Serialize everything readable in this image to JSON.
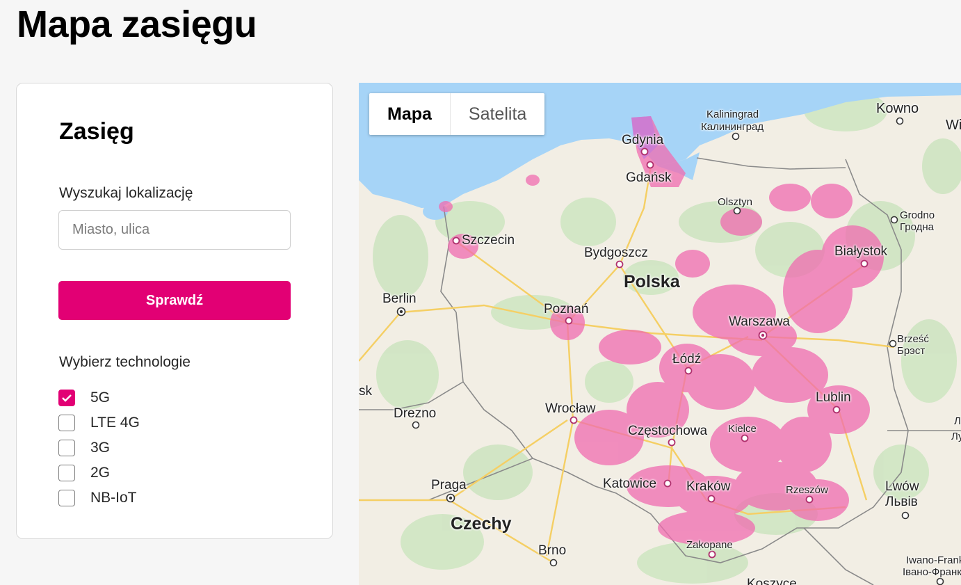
{
  "page": {
    "title": "Mapa zasięgu"
  },
  "panel": {
    "title": "Zasięg",
    "search_label": "Wyszukaj lokalizację",
    "search_placeholder": "Miasto, ulica",
    "search_value": "",
    "button_label": "Sprawdź",
    "tech_label": "Wybierz technologie",
    "technologies": [
      {
        "label": "5G",
        "checked": true
      },
      {
        "label": "LTE 4G",
        "checked": false
      },
      {
        "label": "3G",
        "checked": false
      },
      {
        "label": "2G",
        "checked": false
      },
      {
        "label": "NB-IoT",
        "checked": false
      }
    ]
  },
  "map": {
    "toggle": {
      "map_label": "Mapa",
      "satellite_label": "Satelita",
      "active": "Mapa"
    },
    "colors": {
      "coverage": "#f06cb0",
      "water": "#a6d4f7",
      "accent": "#e20074"
    },
    "labels": {
      "kowno": "Kowno",
      "wi": "Wi",
      "kaliningrad": "Kaliningrad",
      "kaliningrad_ru": "Калининград",
      "gdynia": "Gdynia",
      "gdansk": "Gdańsk",
      "olsztyn": "Olsztyn",
      "grodno": "Grodno",
      "grodno_by": "Гродна",
      "szczecin": "Szczecin",
      "bydgoszcz": "Bydgoszcz",
      "polska": "Polska",
      "bialystok": "Białystok",
      "berlin": "Berlin",
      "poznan": "Poznań",
      "warszawa": "Warszawa",
      "brzesc": "Brześć",
      "brzesc_by": "Брэст",
      "lodz": "Łódź",
      "sk": "sk",
      "lublin": "Lublin",
      "wroclaw": "Wrocław",
      "drezno": "Drezno",
      "czestochowa": "Częstochowa",
      "kielce": "Kielce",
      "l_cut": "Л",
      "lu_cut": "Лу",
      "katowice": "Katowice",
      "krakow": "Kraków",
      "rzeszow": "Rzeszów",
      "praga": "Praga",
      "lwow": "Lwów",
      "lwow_ua": "Львів",
      "czechy": "Czechy",
      "zakopane": "Zakopane",
      "brno": "Brno",
      "iwano": "Iwano-Franki",
      "iwano_ua": "Івано-Франкі",
      "koszyce": "Koszyce"
    }
  }
}
